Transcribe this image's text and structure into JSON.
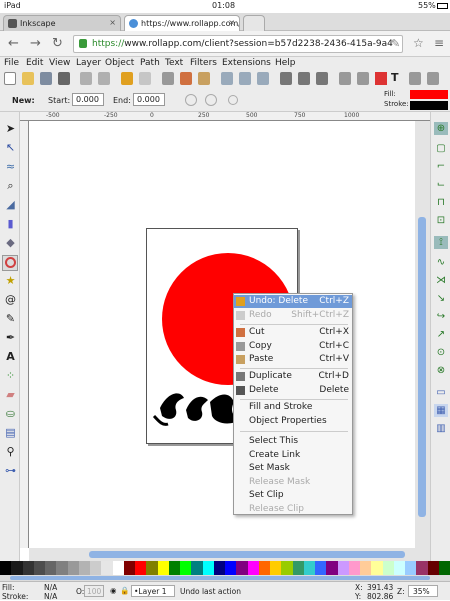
{
  "status": {
    "device": "iPad",
    "time": "01:08",
    "battery": "55%"
  },
  "tabs": [
    {
      "label": "Inkscape",
      "close": "×"
    },
    {
      "label": "https://www.rollapp.com/cli",
      "close": "×"
    }
  ],
  "url": {
    "secure_prefix": "https://",
    "text": "www.rollapp.com/client?session=b57d2238-2436-415a-9a4"
  },
  "menu": [
    "File",
    "Edit",
    "View",
    "Layer",
    "Object",
    "Path",
    "Text",
    "Filters",
    "Extensions",
    "Help"
  ],
  "ctrl": {
    "new_label": "New:",
    "start_label": "Start:",
    "start_value": "0.000",
    "end_label": "End:",
    "end_value": "0.000"
  },
  "fillstroke": {
    "fill_label": "Fill:",
    "stroke_label": "Stroke:",
    "fill_color": "#ff0000",
    "stroke_color": "#000000"
  },
  "ruler": [
    "-500",
    "-250",
    "0",
    "250",
    "500",
    "750",
    "1000"
  ],
  "context_menu": [
    {
      "label": "Undo: Delete",
      "shortcut": "Ctrl+Z",
      "state": "highlight",
      "icon": "undo-icon"
    },
    {
      "label": "Redo",
      "shortcut": "Shift+Ctrl+Z",
      "state": "disabled",
      "icon": "redo-icon"
    },
    {
      "label": "Cut",
      "shortcut": "Ctrl+X",
      "state": "normal",
      "icon": "scissors-icon"
    },
    {
      "label": "Copy",
      "shortcut": "Ctrl+C",
      "state": "normal",
      "icon": "copy-icon"
    },
    {
      "label": "Paste",
      "shortcut": "Ctrl+V",
      "state": "normal",
      "icon": "paste-icon"
    },
    {
      "label": "Duplicate",
      "shortcut": "Ctrl+D",
      "state": "normal",
      "icon": "duplicate-icon"
    },
    {
      "label": "Delete",
      "shortcut": "Delete",
      "state": "normal",
      "icon": "trash-icon"
    },
    {
      "label": "Fill and Stroke",
      "shortcut": "",
      "state": "normal",
      "icon": ""
    },
    {
      "label": "Object Properties",
      "shortcut": "",
      "state": "normal",
      "icon": ""
    },
    {
      "label": "Select This",
      "shortcut": "",
      "state": "normal",
      "icon": ""
    },
    {
      "label": "Create Link",
      "shortcut": "",
      "state": "normal",
      "icon": ""
    },
    {
      "label": "Set Mask",
      "shortcut": "",
      "state": "normal",
      "icon": ""
    },
    {
      "label": "Release Mask",
      "shortcut": "",
      "state": "disabled",
      "icon": ""
    },
    {
      "label": "Set Clip",
      "shortcut": "",
      "state": "normal",
      "icon": ""
    },
    {
      "label": "Release Clip",
      "shortcut": "",
      "state": "disabled",
      "icon": ""
    }
  ],
  "bottom": {
    "fill_label": "Fill:",
    "fill_value": "N/A",
    "stroke_label": "Stroke:",
    "stroke_value": "N/A",
    "opacity_label": "O:",
    "opacity_value": "100",
    "layer": "•Layer 1",
    "message": "Undo last action",
    "x_label": "X:",
    "x_value": "391.43",
    "y_label": "Y:",
    "y_value": "802.86",
    "z_label": "Z:",
    "zoom": "35%"
  },
  "palette": [
    "#000000",
    "#1a1a1a",
    "#333333",
    "#4d4d4d",
    "#666666",
    "#808080",
    "#999999",
    "#b3b3b3",
    "#cccccc",
    "#e6e6e6",
    "#ffffff",
    "#800000",
    "#ff0000",
    "#808000",
    "#ffff00",
    "#008000",
    "#00ff00",
    "#008080",
    "#00ffff",
    "#000080",
    "#0000ff",
    "#800080",
    "#ff00ff",
    "#ff6600",
    "#ffcc00",
    "#99cc00",
    "#339966",
    "#33cccc",
    "#3366ff",
    "#800080",
    "#cc99ff",
    "#ff99cc",
    "#ffcc99",
    "#ffff99",
    "#ccffcc",
    "#ccffff",
    "#99ccff",
    "#993366",
    "#660000",
    "#006600"
  ]
}
